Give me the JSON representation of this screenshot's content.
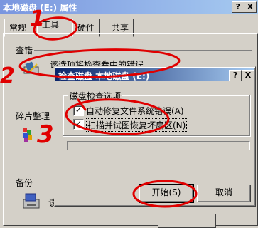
{
  "window": {
    "title": "本地磁盘 (E:) 属性",
    "help_btn": "?",
    "close_btn": "X"
  },
  "tabs": [
    {
      "label": "常规"
    },
    {
      "label": "工具"
    },
    {
      "label": "硬件"
    },
    {
      "label": "共享"
    }
  ],
  "sections": {
    "check": {
      "title": "查错",
      "desc": "该选项将检查卷中的错误。"
    },
    "defrag": {
      "title": "碎片整理"
    },
    "backup": {
      "title": "备份",
      "partial_text": "该"
    }
  },
  "dialog": {
    "title": "检查磁盘 本地磁盘 (E:)",
    "help_btn": "?",
    "close_btn": "X",
    "group_title": "磁盘检查选项",
    "option1": {
      "label": "自动修复文件系统错误(A)",
      "checked": true
    },
    "option2": {
      "label": "扫描并试图恢复坏扇区(N)",
      "checked": true
    },
    "progress": 0,
    "start_label": "开始(S)",
    "cancel_label": "取消"
  },
  "annotations": {
    "n1": "1",
    "n2": "2",
    "n3": "3",
    "color": "#e00000"
  }
}
